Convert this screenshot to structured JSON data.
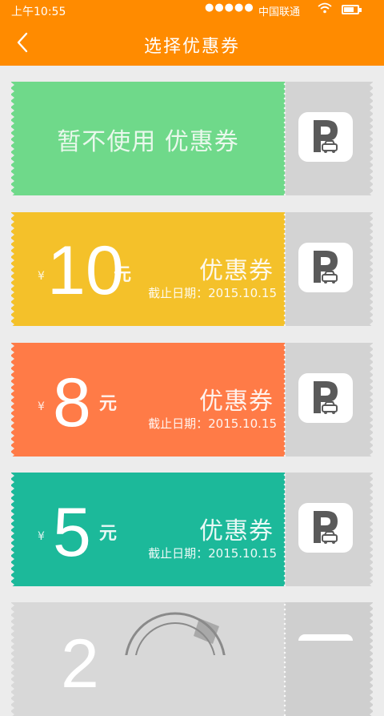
{
  "statusbar": {
    "time": "上午10:55",
    "signal": "●●●●●",
    "carrier": "中国联通",
    "wifi_icon": "wifi-icon",
    "battery_icon": "battery-icon"
  },
  "header": {
    "title": "选择优惠券",
    "back_icon": "chevron-left-icon"
  },
  "colors": {
    "header": "#ff8b00",
    "green": "#6fd98a",
    "yellow": "#f4c12a",
    "orange": "#ff7b47",
    "teal": "#1cb99a",
    "gray": "#d3d3d3"
  },
  "coupons": [
    {
      "type": "none",
      "label": "暂不使用 优惠券",
      "color": "#6fd98a",
      "icon": "parking-car-icon"
    },
    {
      "type": "value",
      "currency": "¥",
      "amount": "10",
      "unit": "元",
      "title": "优惠券",
      "deadline": "截止日期：2015.10.15",
      "color": "#f4c12a",
      "icon": "parking-car-icon"
    },
    {
      "type": "value",
      "currency": "¥",
      "amount": "8",
      "unit": "元",
      "title": "优惠券",
      "deadline": "截止日期：2015.10.15",
      "color": "#ff7b47",
      "icon": "parking-car-icon"
    },
    {
      "type": "value",
      "currency": "¥",
      "amount": "5",
      "unit": "元",
      "title": "优惠券",
      "deadline": "截止日期：2015.10.15",
      "color": "#1cb99a",
      "icon": "parking-car-icon"
    },
    {
      "type": "used",
      "amount": "2",
      "color": "#d3d3d3",
      "icon": "parking-car-icon"
    }
  ]
}
